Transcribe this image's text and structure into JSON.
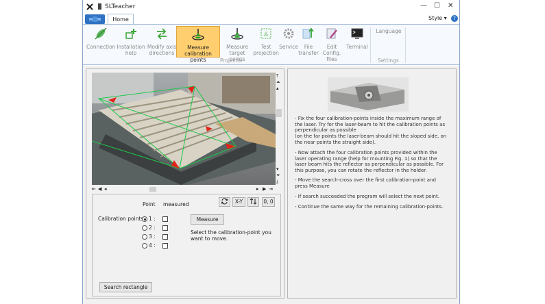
{
  "window": {
    "title": "SLTeacher",
    "style_menu": "Style"
  },
  "tabs": [
    {
      "label": "Home"
    }
  ],
  "ribbon": {
    "buttons": [
      {
        "label": "Connection",
        "icon": "connection-icon",
        "enabled": false
      },
      {
        "label": "Installation help",
        "icon": "installation-help-icon",
        "enabled": false
      },
      {
        "label": "Modify axis directions",
        "icon": "axis-directions-icon",
        "enabled": false
      },
      {
        "label": "Measure calibration points",
        "icon": "measure-calibration-icon",
        "enabled": true,
        "active": true
      },
      {
        "label": "Measure target points",
        "icon": "measure-target-icon",
        "enabled": true
      },
      {
        "label": "Test projection",
        "icon": "test-projection-icon",
        "enabled": false
      },
      {
        "label": "Service",
        "icon": "service-gear-icon",
        "enabled": false
      },
      {
        "label": "File transfer",
        "icon": "file-transfer-icon",
        "enabled": false
      },
      {
        "label": "Edit Config. files",
        "icon": "edit-config-icon",
        "enabled": false
      },
      {
        "label": "Terminal",
        "icon": "terminal-icon",
        "enabled": true
      }
    ],
    "language": "Language",
    "groups": {
      "projector": "Projector",
      "settings": "Settings"
    }
  },
  "calibration": {
    "col_point": "Point",
    "col_measured": "measured",
    "row_label": "Calibration points",
    "points": [
      {
        "label": "1 :",
        "selected": true
      },
      {
        "label": "2 :",
        "selected": false
      },
      {
        "label": "3 :",
        "selected": false
      },
      {
        "label": "4 :",
        "selected": false
      }
    ],
    "measure_button": "Measure",
    "hint": "Select the calibration-point you want to move.",
    "xy_button": "X-Y",
    "origin_button": "0, 0",
    "search_button": "Search rectangle"
  },
  "instructions": [
    "- Fix the four calibration-points inside the maximum range of the laser. Try for the laser-beam to hit the calibration points as perpendicular as possible",
    "(on the far points the laser-beam should hit the sloped side, on the near points the straight side).",
    "- Now attach the four calibration points provided within the laser operating range (help for mounting Fig. 1) so that the laser beam hits the reflector as perpendicular as possible. For this purpose, you can rotate the reflector in the holder.",
    "- Move the search-cross over the first calibration-point and press Measure",
    "- If search succeeded the program will select the next point.",
    "- Continue the same way for the remaining calibration-points."
  ],
  "colors": {
    "accent": "#2e72c4",
    "active_button": "#ffcf6f",
    "laser_green": "#1ec94a",
    "marker_red": "#e2231a"
  }
}
